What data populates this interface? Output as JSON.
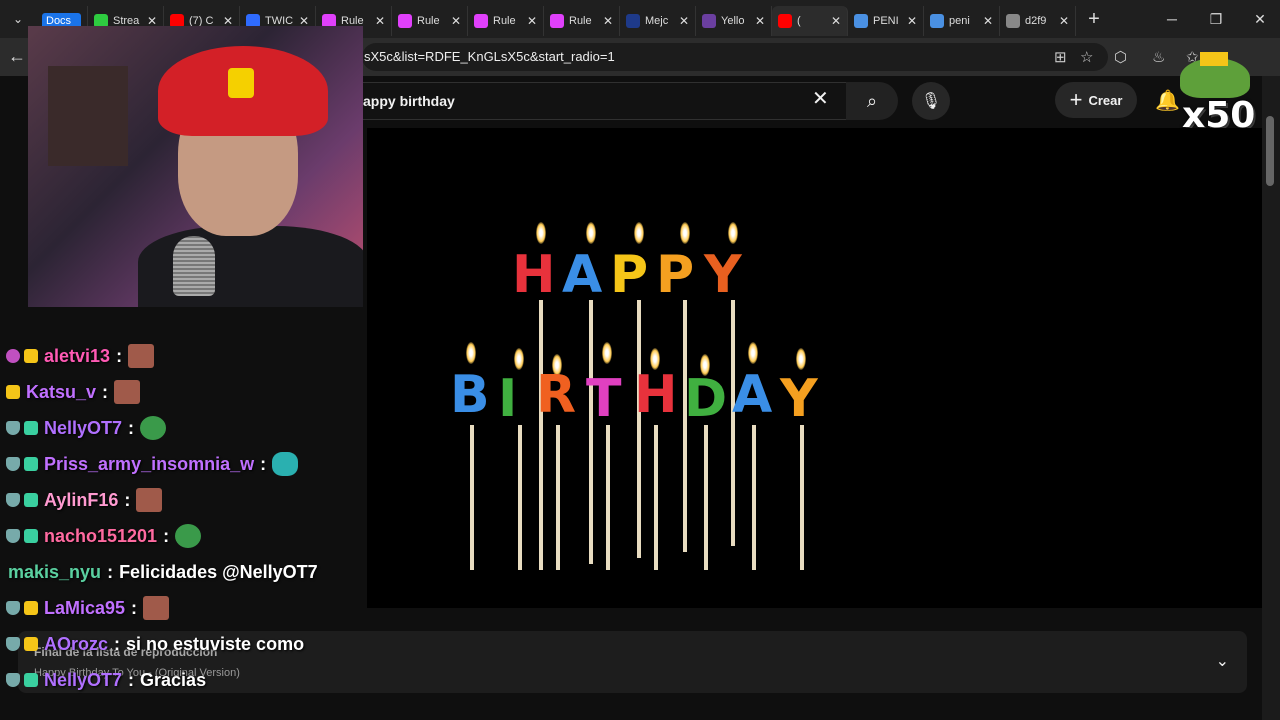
{
  "browser": {
    "tabs": [
      {
        "label": "Docs",
        "color": "#1a73e8"
      },
      {
        "label": "Strea",
        "color": "#2ecc40"
      },
      {
        "label": "(7) C",
        "color": "#ff0000"
      },
      {
        "label": "TWIC",
        "color": "#2f6bff"
      },
      {
        "label": "Rule",
        "color": "#e040fb"
      },
      {
        "label": "Rule",
        "color": "#e040fb"
      },
      {
        "label": "Rule",
        "color": "#e040fb"
      },
      {
        "label": "Rule",
        "color": "#e040fb"
      },
      {
        "label": "Mejc",
        "color": "#1e3a8a"
      },
      {
        "label": "Yello",
        "color": "#6b3fa0"
      },
      {
        "label": "(",
        "color": "#ff0000"
      },
      {
        "label": "PENI",
        "color": "#4a90e2"
      },
      {
        "label": "peni",
        "color": "#4a90e2"
      },
      {
        "label": "d2f9",
        "color": "#888888"
      }
    ],
    "url": "sX5c&list=RDFE_KnGLsX5c&start_radio=1"
  },
  "youtube": {
    "search_value": "appy birthday",
    "create_label": "Crear"
  },
  "overlay": {
    "multiplier": "x50"
  },
  "video": {
    "happy_letters": [
      "H",
      "A",
      "P",
      "P",
      "Y"
    ],
    "birthday_letters": [
      "B",
      "I",
      "R",
      "T",
      "H",
      "D",
      "A",
      "Y"
    ]
  },
  "playlist": {
    "title": "Final de la lista de reproducción",
    "subtitle": "Happy Birthday To You - (Original Version)"
  },
  "chat": [
    {
      "user": "aletvi13",
      "text": "",
      "color": "#ff5ab4",
      "badges": [
        "heart",
        "crown"
      ],
      "emote": "face"
    },
    {
      "user": "Katsu_v",
      "text": "",
      "color": "#c070ff",
      "badges": [
        "crown"
      ],
      "emote": "face"
    },
    {
      "user": "NellyOT7",
      "text": "",
      "color": "#b070ff",
      "badges": [
        "shield",
        "grid"
      ],
      "emote": "pepe"
    },
    {
      "user": "Priss_army_insomnia_w",
      "text": "",
      "color": "#c070ff",
      "badges": [
        "shield",
        "grid"
      ],
      "emote": "teal"
    },
    {
      "user": "AylinF16",
      "text": "",
      "color": "#ff9ad0",
      "badges": [
        "shield",
        "grid"
      ],
      "emote": "face"
    },
    {
      "user": "nacho151201",
      "text": "",
      "color": "#ff6aa0",
      "badges": [
        "shield",
        "grid"
      ],
      "emote": "pepe"
    },
    {
      "user": "makis_nyu",
      "text": "Felicidades @NellyOT7",
      "color": "#5ad0a0",
      "badges": [],
      "emote": ""
    },
    {
      "user": "LaMica95",
      "text": "",
      "color": "#c070ff",
      "badges": [
        "shield",
        "crown"
      ],
      "emote": "face"
    },
    {
      "user": "AOrozc",
      "text": "si no estuviste como",
      "color": "#b070ff",
      "badges": [
        "shield",
        "crown"
      ],
      "emote": ""
    },
    {
      "user": "NellyOT7",
      "text": "Gracias",
      "color": "#b070ff",
      "badges": [
        "shield",
        "grid"
      ],
      "emote": ""
    }
  ]
}
